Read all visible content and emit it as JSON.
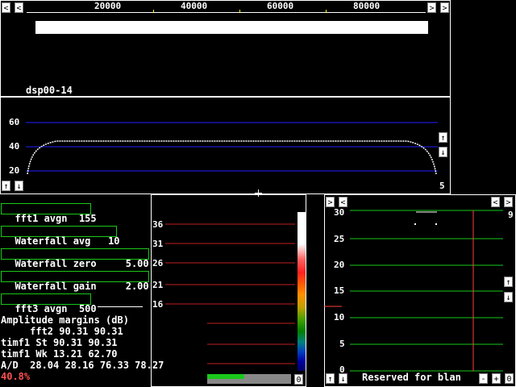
{
  "top": {
    "freq_ticks": [
      "20000",
      "40000",
      "60000",
      "80000"
    ],
    "device_label": "dsp00-14"
  },
  "spectrum": {
    "y_ticks": [
      "60",
      "40",
      "20"
    ],
    "right_value": "5"
  },
  "params": [
    {
      "label": "fft1 avgn",
      "value": "155"
    },
    {
      "label": "Waterfall avg",
      "value": "10"
    },
    {
      "label": "Waterfall zero",
      "value": "5.00"
    },
    {
      "label": "Waterfall gain",
      "value": "2.00"
    },
    {
      "label": "fft3 avgn",
      "value": "500"
    }
  ],
  "margins": {
    "title": "Amplitude margins (dB)",
    "rows": [
      {
        "name": "     fft2",
        "v1": "90.31",
        "v2": "90.31"
      },
      {
        "name": "timf1 St",
        "v1": "90.31",
        "v2": "90.31"
      },
      {
        "name": "timf1 Wk",
        "v1": "13.21",
        "v2": "62.70"
      }
    ],
    "ad_line": "A/D  28.04 28.16 76.33 78.27",
    "percent": "40.8%",
    "percent_color": "#ff5050"
  },
  "waterfall": {
    "ticks": [
      "36",
      "31",
      "26",
      "21",
      "16"
    ],
    "zero_button": "0"
  },
  "baseband": {
    "y_ticks": [
      "30",
      "25",
      "20",
      "15",
      "10",
      "5",
      "0"
    ],
    "right_value": "9",
    "status": "Reserved for blan",
    "minus": "-",
    "plus": "+",
    "zero": "0"
  },
  "icons": {
    "left": "left-arrow-icon",
    "right": "right-arrow-icon",
    "up": "up-arrow-icon",
    "down": "down-arrow-icon"
  }
}
